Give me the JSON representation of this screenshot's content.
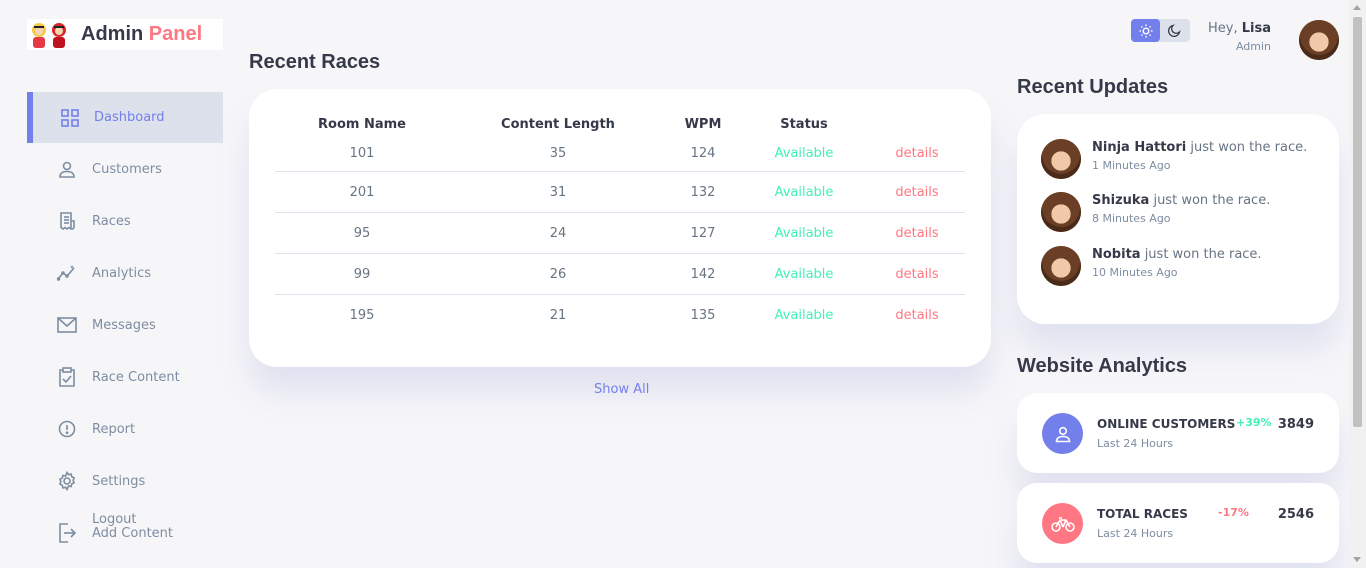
{
  "brand": {
    "title_main": "Admin ",
    "title_accent": "Panel"
  },
  "sidebar": {
    "items": [
      {
        "label": "Dashboard",
        "icon": "grid-icon"
      },
      {
        "label": "Customers",
        "icon": "person-icon"
      },
      {
        "label": "Races",
        "icon": "receipt-icon"
      },
      {
        "label": "Analytics",
        "icon": "insights-icon"
      },
      {
        "label": "Messages",
        "icon": "mail-icon"
      },
      {
        "label": "Race Content",
        "icon": "clipboard-check-icon"
      },
      {
        "label": "Report",
        "icon": "alert-circle-icon"
      },
      {
        "label": "Settings",
        "icon": "gear-icon"
      },
      {
        "label": "Add Content",
        "icon": "logout-icon"
      }
    ],
    "logout_label": "Logout"
  },
  "main": {
    "title": "Recent Races",
    "columns": [
      "Room Name",
      "Content Length",
      "WPM",
      "Status",
      ""
    ],
    "rows": [
      {
        "room": "101",
        "length": "35",
        "wpm": "124",
        "status": "Available",
        "action": "details"
      },
      {
        "room": "201",
        "length": "31",
        "wpm": "132",
        "status": "Available",
        "action": "details"
      },
      {
        "room": "95",
        "length": "24",
        "wpm": "127",
        "status": "Available",
        "action": "details"
      },
      {
        "room": "99",
        "length": "26",
        "wpm": "142",
        "status": "Available",
        "action": "details"
      },
      {
        "room": "195",
        "length": "21",
        "wpm": "135",
        "status": "Available",
        "action": "details"
      }
    ],
    "show_all": "Show All"
  },
  "top": {
    "greeting": "Hey, ",
    "user": "Lisa",
    "role": "Admin"
  },
  "updates": {
    "title": "Recent Updates",
    "items": [
      {
        "name": "Ninja Hattori",
        "text": " just won the race.",
        "time": "1 Minutes Ago"
      },
      {
        "name": "Shizuka",
        "text": " just won the race.",
        "time": "8 Minutes Ago"
      },
      {
        "name": "Nobita",
        "text": " just won the race.",
        "time": "10 Minutes Ago"
      }
    ]
  },
  "analytics": {
    "title": "Website Analytics",
    "cards": [
      {
        "name": "ONLINE CUSTOMERS",
        "sub": "Last 24 Hours",
        "pct": "+39%",
        "value": "3849",
        "color": "#7380ec",
        "pct_color": "#41f1b6",
        "icon": "person-icon"
      },
      {
        "name": "TOTAL RACES",
        "sub": "Last 24 Hours",
        "pct": "-17%",
        "value": "2546",
        "color": "#ff7782",
        "pct_color": "#ff7782",
        "icon": "bicycle-icon"
      }
    ]
  }
}
